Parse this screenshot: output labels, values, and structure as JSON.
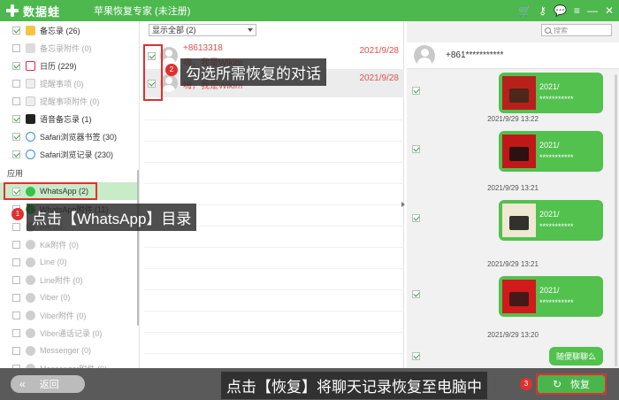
{
  "title": {
    "brand": "数据蛙",
    "window_title": "苹果恢复专家 (未注册)",
    "icons": [
      "cart-icon",
      "key-icon",
      "chat-icon",
      "menu-icon",
      "minimize-icon",
      "close-icon"
    ]
  },
  "sidebar": {
    "items": [
      {
        "label": "备忘录 (26)",
        "checked": true,
        "enabled": true,
        "icon": "notes-icon"
      },
      {
        "label": "备忘录附件 (0)",
        "checked": false,
        "enabled": false,
        "icon": "notes-attachment-icon"
      },
      {
        "label": "日历 (229)",
        "checked": true,
        "enabled": true,
        "icon": "calendar-icon"
      },
      {
        "label": "提醒事项 (0)",
        "checked": false,
        "enabled": false,
        "icon": "reminder-icon"
      },
      {
        "label": "提醒事项附件 (0)",
        "checked": false,
        "enabled": false,
        "icon": "reminder-attachment-icon"
      },
      {
        "label": "语音备忘录 (1)",
        "checked": true,
        "enabled": true,
        "icon": "voice-memo-icon"
      },
      {
        "label": "Safari浏览器书签 (30)",
        "checked": true,
        "enabled": true,
        "icon": "safari-bookmark-icon"
      },
      {
        "label": "Safari浏览记录 (230)",
        "checked": true,
        "enabled": true,
        "icon": "safari-history-icon"
      }
    ],
    "section_apps": "应用",
    "apps": [
      {
        "label": "WhatsApp (2)",
        "checked": true,
        "enabled": true,
        "selected": true,
        "icon": "whatsapp-icon"
      },
      {
        "label": "WhatsApp附件 (11)",
        "checked": true,
        "enabled": true,
        "icon": "whatsapp-attachment-icon"
      },
      {
        "label": "Kik (0)",
        "checked": false,
        "enabled": false,
        "icon": "kik-icon"
      },
      {
        "label": "Kik附件 (0)",
        "checked": false,
        "enabled": false,
        "icon": "kik-attachment-icon"
      },
      {
        "label": "Line (0)",
        "checked": false,
        "enabled": false,
        "icon": "line-icon"
      },
      {
        "label": "Line附件 (0)",
        "checked": false,
        "enabled": false,
        "icon": "line-attachment-icon"
      },
      {
        "label": "Viber (0)",
        "checked": false,
        "enabled": false,
        "icon": "viber-icon"
      },
      {
        "label": "Viber附件 (0)",
        "checked": false,
        "enabled": false,
        "icon": "viber-attachment-icon"
      },
      {
        "label": "Viber通话记录 (0)",
        "checked": false,
        "enabled": false,
        "icon": "viber-calls-icon"
      },
      {
        "label": "Messenger (0)",
        "checked": false,
        "enabled": false,
        "icon": "messenger-icon"
      },
      {
        "label": "Messenger附件 (0)",
        "checked": false,
        "enabled": false,
        "icon": "messenger-attachment-icon"
      }
    ]
  },
  "middle": {
    "filter": "显示全部 (2)",
    "conversations": [
      {
        "name": "+8613318",
        "preview": "嗨，我是Wikim",
        "date": "2021/9/28",
        "checked": true
      },
      {
        "name": "",
        "preview": "嗨，我是Wikim",
        "date": "2021/9/28",
        "checked": true
      }
    ]
  },
  "chat": {
    "search_placeholder": "搜索",
    "contact": "+861***********",
    "messages": [
      {
        "kind": "image",
        "line1": "2021/",
        "line2": "***********",
        "thumb_color": "#b8201c",
        "thumb_accent": "#3a2a1a"
      },
      {
        "kind": "timestamp",
        "text": "2021/9/29 13:22"
      },
      {
        "kind": "image",
        "line1": "2021/",
        "line2": "***********",
        "thumb_color": "#c01818",
        "thumb_accent": "#111111"
      },
      {
        "kind": "timestamp",
        "text": "2021/9/29 13:21"
      },
      {
        "kind": "image",
        "line1": "2021/",
        "line2": "***********",
        "thumb_color": "#efe8d2",
        "thumb_accent": "#101010"
      },
      {
        "kind": "timestamp",
        "text": "2021/9/29 13:21"
      },
      {
        "kind": "image",
        "line1": "2021/",
        "line2": "***********",
        "thumb_color": "#d11a1a",
        "thumb_accent": "#2a1a1a"
      },
      {
        "kind": "timestamp",
        "text": "2021/9/29 13:20"
      },
      {
        "kind": "text",
        "text": "随便聊聊么"
      }
    ]
  },
  "bottom": {
    "back_label": "返回",
    "recover_label": "恢复"
  },
  "annotations": {
    "step1": {
      "badge": "1",
      "text": "点击【WhatsApp】目录"
    },
    "step2": {
      "badge": "2",
      "text": "勾选所需恢复的对话"
    },
    "step3": {
      "badge": "3",
      "text": "点击【恢复】将聊天记录恢复至电脑中"
    }
  },
  "colors": {
    "brand_green": "#4cb84e",
    "annotation_red": "#e03030",
    "bubble_green": "#52c14e"
  }
}
